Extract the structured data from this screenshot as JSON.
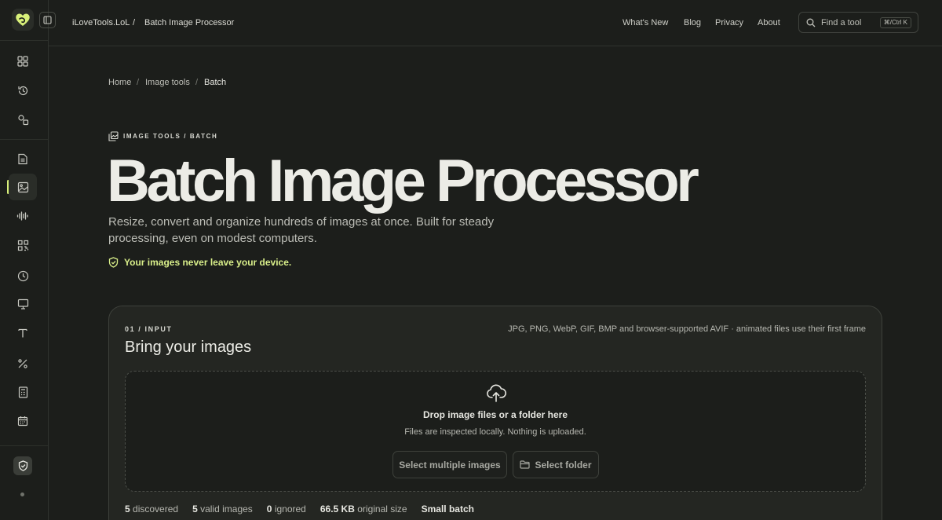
{
  "sidebar": {
    "icons": [
      "grid-icon",
      "history-icon",
      "shapes-icon",
      "document-icon",
      "image-icon",
      "audio-wave-icon",
      "qr-code-icon",
      "clock-icon",
      "monitor-icon",
      "text-icon",
      "percent-icon",
      "calculator-icon",
      "calendar-icon",
      "shield-check-icon"
    ]
  },
  "topbar": {
    "site": "iLoveTools.LoL",
    "separator": "/",
    "page": "Batch Image Processor",
    "nav": [
      "What's New",
      "Blog",
      "Privacy",
      "About"
    ],
    "search_placeholder": "Find a tool",
    "shortcut": "⌘/Ctrl K"
  },
  "breadcrumb": {
    "items": [
      "Home",
      "Image tools",
      "Batch"
    ],
    "separator": "/"
  },
  "hero": {
    "eyebrow": "IMAGE TOOLS / BATCH",
    "title": "Batch Image Processor",
    "subtitle": "Resize, convert and organize hundreds of images at once. Built for steady processing, even on modest computers.",
    "privacy_note": "Your images never leave your device."
  },
  "input_card": {
    "step": "01 / INPUT",
    "title": "Bring your images",
    "formats": "JPG, PNG, WebP, GIF, BMP and browser-supported AVIF · animated files use their first frame",
    "drop_title": "Drop image files or a folder here",
    "drop_subtitle": "Files are inspected locally. Nothing is uploaded.",
    "select_images_label": "Select multiple images",
    "select_folder_label": "Select folder",
    "stats": {
      "discovered_count": "5",
      "discovered_label": "discovered",
      "valid_count": "5",
      "valid_label": "valid images",
      "ignored_count": "0",
      "ignored_label": "ignored",
      "size_value": "66.5 KB",
      "size_label": "original size",
      "batch_label": "Small batch"
    }
  },
  "colors": {
    "background": "#1c1e1b",
    "accent": "#d8f07a",
    "card": "#242622"
  }
}
